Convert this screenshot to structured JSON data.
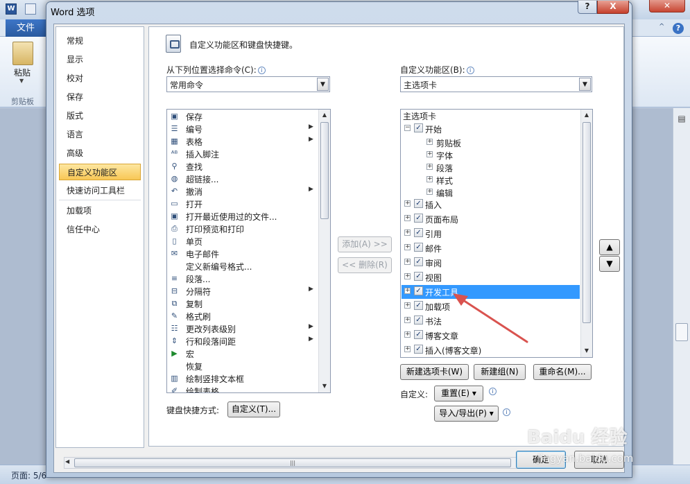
{
  "word": {
    "file_tab": "文件",
    "paste_label": "粘贴",
    "clipboard_group": "剪贴板",
    "status_page": "页面: 5/6",
    "help_glyph": "?",
    "collapse_glyph": "^"
  },
  "dialog": {
    "title": "Word 选项",
    "help_btn": "?",
    "close_btn": "X",
    "nav_items": [
      "常规",
      "显示",
      "校对",
      "保存",
      "版式",
      "语言",
      "高级",
      "自定义功能区",
      "快速访问工具栏",
      "加载项",
      "信任中心"
    ],
    "active_nav": "自定义功能区",
    "heading": "自定义功能区和键盘快捷键。",
    "choose_label": "从下列位置选择命令(C):",
    "choose_value": "常用命令",
    "customize_label": "自定义功能区(B):",
    "customize_value": "主选项卡",
    "commands": [
      {
        "icon": "save-icon",
        "label": "保存",
        "sub": false
      },
      {
        "icon": "numbering-icon",
        "label": "编号",
        "sub": true
      },
      {
        "icon": "table-icon",
        "label": "表格",
        "sub": true
      },
      {
        "icon": "footnote-icon",
        "label": "插入脚注",
        "sub": false
      },
      {
        "icon": "find-icon",
        "label": "查找",
        "sub": false
      },
      {
        "icon": "hyperlink-icon",
        "label": "超链接...",
        "sub": false
      },
      {
        "icon": "undo-icon",
        "label": "撤消",
        "sub": true
      },
      {
        "icon": "open-icon",
        "label": "打开",
        "sub": false
      },
      {
        "icon": "recent-file-icon",
        "label": "打开最近使用过的文件...",
        "sub": false
      },
      {
        "icon": "print-preview-icon",
        "label": "打印预览和打印",
        "sub": false
      },
      {
        "icon": "single-page-icon",
        "label": "单页",
        "sub": false
      },
      {
        "icon": "email-icon",
        "label": "电子邮件",
        "sub": false
      },
      {
        "icon": "",
        "label": "定义新编号格式...",
        "sub": false
      },
      {
        "icon": "paragraph-icon",
        "label": "段落...",
        "sub": false
      },
      {
        "icon": "page-break-icon",
        "label": "分隔符",
        "sub": true
      },
      {
        "icon": "copy-icon",
        "label": "复制",
        "sub": false
      },
      {
        "icon": "format-painter-icon",
        "label": "格式刷",
        "sub": false
      },
      {
        "icon": "list-level-icon",
        "label": "更改列表级别",
        "sub": true
      },
      {
        "icon": "line-spacing-icon",
        "label": "行和段落间距",
        "sub": true
      },
      {
        "icon": "macro-icon",
        "label": "宏",
        "sub": false
      },
      {
        "icon": "",
        "label": "恢复",
        "sub": false
      },
      {
        "icon": "vertical-textbox-icon",
        "label": "绘制竖排文本框",
        "sub": false
      },
      {
        "icon": "draw-table-icon",
        "label": "绘制表格",
        "sub": false
      }
    ],
    "add_btn": "添加(A) >>",
    "remove_btn": "<< 删除(R)",
    "tree_header": "主选项卡",
    "tree": [
      {
        "label": "开始",
        "level": 0,
        "expander": "−",
        "checked": true
      },
      {
        "label": "剪贴板",
        "level": 1,
        "expander": "+",
        "checked": false
      },
      {
        "label": "字体",
        "level": 1,
        "expander": "+",
        "checked": false
      },
      {
        "label": "段落",
        "level": 1,
        "expander": "+",
        "checked": false
      },
      {
        "label": "样式",
        "level": 1,
        "expander": "+",
        "checked": false
      },
      {
        "label": "编辑",
        "level": 1,
        "expander": "+",
        "checked": false
      },
      {
        "label": "插入",
        "level": 0,
        "expander": "+",
        "checked": true
      },
      {
        "label": "页面布局",
        "level": 0,
        "expander": "+",
        "checked": true
      },
      {
        "label": "引用",
        "level": 0,
        "expander": "+",
        "checked": true
      },
      {
        "label": "邮件",
        "level": 0,
        "expander": "+",
        "checked": true
      },
      {
        "label": "审阅",
        "level": 0,
        "expander": "+",
        "checked": true
      },
      {
        "label": "视图",
        "level": 0,
        "expander": "+",
        "checked": true
      },
      {
        "label": "开发工具",
        "level": 0,
        "expander": "+",
        "checked": true,
        "selected": true
      },
      {
        "label": "加载项",
        "level": 0,
        "expander": "+",
        "checked": true
      },
      {
        "label": "书法",
        "level": 0,
        "expander": "+",
        "checked": true
      },
      {
        "label": "博客文章",
        "level": 0,
        "expander": "+",
        "checked": true
      },
      {
        "label": "插入(博客文章)",
        "level": 0,
        "expander": "+",
        "checked": true
      }
    ],
    "new_tab_btn": "新建选项卡(W)",
    "new_group_btn": "新建组(N)",
    "rename_btn": "重命名(M)...",
    "customize_text": "自定义:",
    "reset_btn": "重置(E) ▾",
    "import_export_btn": "导入/导出(P) ▾",
    "keyboard_label": "键盘快捷方式:",
    "keyboard_btn": "自定义(T)...",
    "ok_btn": "确定",
    "cancel_btn": "取消",
    "move_up": "▲",
    "move_down": "▼"
  },
  "watermark": {
    "text": "Baidu 经验",
    "sub": "jingyan.baidu.com"
  },
  "colors": {
    "selection": "#3399ff",
    "active_nav": "#f8c755",
    "arrow": "#d9534f"
  }
}
